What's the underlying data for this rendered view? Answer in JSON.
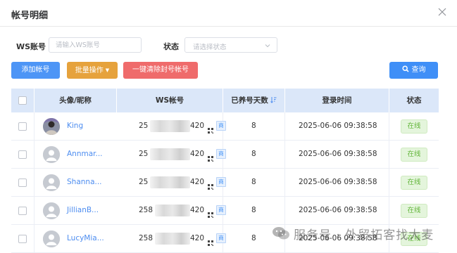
{
  "dialog": {
    "title": "帐号明细"
  },
  "filters": {
    "ws_label": "WS账号",
    "ws_placeholder": "请输入WS账号",
    "status_label": "状态",
    "status_placeholder": "请选择状态"
  },
  "toolbar": {
    "add_label": "添加帐号",
    "batch_label": "批量操作",
    "clear_label": "一键清除封号帐号",
    "search_label": "查询"
  },
  "table": {
    "headers": {
      "avatar_nick": "头像/昵称",
      "ws": "WS帐号",
      "days": "已养号天数",
      "login": "登录时间",
      "status": "状态"
    },
    "rows": [
      {
        "nick": "King",
        "ws_prefix": "25",
        "ws_suffix": "420",
        "tag": "商",
        "days": "8",
        "login": "2025-06-06 09:38:58",
        "status": "在线",
        "avatar": "photo-avatar"
      },
      {
        "nick": "Annmar...",
        "ws_prefix": "25",
        "ws_suffix": "420",
        "tag": "商",
        "days": "8",
        "login": "2025-06-06 09:38:58",
        "status": "在线",
        "avatar": "default-avatar"
      },
      {
        "nick": "Shanna...",
        "ws_prefix": "25",
        "ws_suffix": "420",
        "tag": "商",
        "days": "8",
        "login": "2025-06-06 09:38:58",
        "status": "在线",
        "avatar": "default-avatar"
      },
      {
        "nick": "JillianB...",
        "ws_prefix": "258",
        "ws_suffix": "420",
        "tag": "商",
        "days": "8",
        "login": "2025-06-06 09:38:58",
        "status": "在线",
        "avatar": "default-avatar"
      },
      {
        "nick": "LucyMia...",
        "ws_prefix": "258",
        "ws_suffix": "420",
        "tag": "商",
        "days": "8",
        "login": "2025-06-06 09:38:58",
        "status": "在线",
        "avatar": "default-avatar"
      }
    ]
  },
  "watermark": {
    "text": "服务号 · 外贸拓客找大麦"
  },
  "colors": {
    "primary": "#4d95f6",
    "warning": "#e6a23c",
    "danger": "#ef6b6b",
    "header_bg": "#dbe7f9",
    "link": "#4d8df0",
    "online": "#62b53a"
  }
}
